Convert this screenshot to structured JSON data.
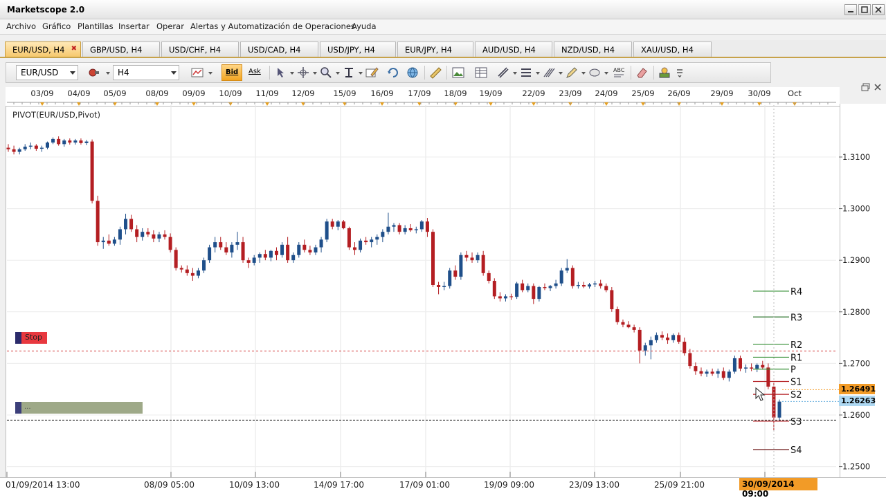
{
  "app": {
    "title": "Marketscope 2.0"
  },
  "menu": [
    "Archivo",
    "Gráfico",
    "Plantillas",
    "Insertar",
    "Operar",
    "Alertas y Automatización de Operaciones",
    "Ayuda"
  ],
  "tabs": [
    "EUR/USD, H4",
    "GBP/USD, H4",
    "USD/CHF, H4",
    "USD/CAD, H4",
    "USD/JPY, H4",
    "EUR/JPY, H4",
    "AUD/USD, H4",
    "NZD/USD, H4",
    "XAU/USD, H4"
  ],
  "toolbar": {
    "symbol": "EUR/USD",
    "timeframe": "H4",
    "bid_label": "Bid",
    "ask_label": "Ask"
  },
  "top_dates": [
    "03/09",
    "04/09",
    "05/09",
    "08/09",
    "09/09",
    "10/09",
    "11/09",
    "12/09",
    "15/09",
    "16/09",
    "17/09",
    "18/09",
    "19/09",
    "22/09",
    "23/09",
    "24/09",
    "25/09",
    "26/09",
    "29/09",
    "30/09",
    "Oct"
  ],
  "indicator": "PIVOT(EUR/USD,Pivot)",
  "price_axis": [
    "1.3100",
    "1.3000",
    "1.2900",
    "1.2800",
    "1.2700",
    "1.2600",
    "1.2500"
  ],
  "bottom_times": [
    "01/09/2014 13:00",
    "08/09 05:00",
    "10/09 13:00",
    "14/09 17:00",
    "17/09 01:00",
    "19/09 09:00",
    "23/09 13:00",
    "25/09 21:00"
  ],
  "cursor_time": "30/09/2014 09:00",
  "current_prices": {
    "bid": "1.26491",
    "ask": "1.26263"
  },
  "markers": {
    "stop": "Stop",
    "order": "..."
  },
  "pivots": [
    "R4",
    "R3",
    "R2",
    "R1",
    "P",
    "S1",
    "S2",
    "S3",
    "S4"
  ],
  "colors": {
    "bull": "#1f4f8a",
    "bear": "#b41e22",
    "accent": "#f29b27",
    "tab_active": "#f6c86d"
  },
  "chart_data": {
    "type": "candlestick",
    "symbol": "EUR/USD",
    "timeframe": "H4",
    "ylim": [
      1.248,
      1.318
    ],
    "candles": [
      {
        "o": 1.3118,
        "h": 1.3125,
        "l": 1.311,
        "c": 1.3115
      },
      {
        "o": 1.3115,
        "h": 1.3122,
        "l": 1.3105,
        "c": 1.311
      },
      {
        "o": 1.311,
        "h": 1.3118,
        "l": 1.3105,
        "c": 1.3115
      },
      {
        "o": 1.3115,
        "h": 1.3125,
        "l": 1.3112,
        "c": 1.312
      },
      {
        "o": 1.312,
        "h": 1.3128,
        "l": 1.3115,
        "c": 1.3122
      },
      {
        "o": 1.3122,
        "h": 1.3125,
        "l": 1.3112,
        "c": 1.3116
      },
      {
        "o": 1.3116,
        "h": 1.3122,
        "l": 1.311,
        "c": 1.3118
      },
      {
        "o": 1.3118,
        "h": 1.313,
        "l": 1.3115,
        "c": 1.3128
      },
      {
        "o": 1.3128,
        "h": 1.3138,
        "l": 1.3125,
        "c": 1.3135
      },
      {
        "o": 1.3135,
        "h": 1.314,
        "l": 1.3122,
        "c": 1.3125
      },
      {
        "o": 1.3125,
        "h": 1.3135,
        "l": 1.312,
        "c": 1.3132
      },
      {
        "o": 1.3132,
        "h": 1.3136,
        "l": 1.3124,
        "c": 1.3128
      },
      {
        "o": 1.3128,
        "h": 1.3135,
        "l": 1.3124,
        "c": 1.3132
      },
      {
        "o": 1.3132,
        "h": 1.3136,
        "l": 1.3124,
        "c": 1.3127
      },
      {
        "o": 1.3127,
        "h": 1.3133,
        "l": 1.3123,
        "c": 1.313
      },
      {
        "o": 1.313,
        "h": 1.3134,
        "l": 1.301,
        "c": 1.3015
      },
      {
        "o": 1.3015,
        "h": 1.3025,
        "l": 1.2928,
        "c": 1.2935
      },
      {
        "o": 1.2935,
        "h": 1.2945,
        "l": 1.2922,
        "c": 1.2938
      },
      {
        "o": 1.2938,
        "h": 1.295,
        "l": 1.2928,
        "c": 1.2932
      },
      {
        "o": 1.2932,
        "h": 1.2945,
        "l": 1.2928,
        "c": 1.294
      },
      {
        "o": 1.294,
        "h": 1.2965,
        "l": 1.293,
        "c": 1.296
      },
      {
        "o": 1.296,
        "h": 1.299,
        "l": 1.295,
        "c": 1.298
      },
      {
        "o": 1.298,
        "h": 1.2988,
        "l": 1.2955,
        "c": 1.296
      },
      {
        "o": 1.296,
        "h": 1.2968,
        "l": 1.2935,
        "c": 1.2945
      },
      {
        "o": 1.2945,
        "h": 1.2962,
        "l": 1.2938,
        "c": 1.2955
      },
      {
        "o": 1.2955,
        "h": 1.2962,
        "l": 1.2945,
        "c": 1.295
      },
      {
        "o": 1.295,
        "h": 1.2958,
        "l": 1.2935,
        "c": 1.2942
      },
      {
        "o": 1.2942,
        "h": 1.2955,
        "l": 1.2935,
        "c": 1.295
      },
      {
        "o": 1.295,
        "h": 1.2958,
        "l": 1.294,
        "c": 1.2945
      },
      {
        "o": 1.2945,
        "h": 1.2952,
        "l": 1.2915,
        "c": 1.292
      },
      {
        "o": 1.292,
        "h": 1.2925,
        "l": 1.288,
        "c": 1.2885
      },
      {
        "o": 1.2885,
        "h": 1.289,
        "l": 1.2876,
        "c": 1.2882
      },
      {
        "o": 1.2882,
        "h": 1.289,
        "l": 1.287,
        "c": 1.2875
      },
      {
        "o": 1.2875,
        "h": 1.2885,
        "l": 1.286,
        "c": 1.287
      },
      {
        "o": 1.287,
        "h": 1.2885,
        "l": 1.2865,
        "c": 1.288
      },
      {
        "o": 1.288,
        "h": 1.2905,
        "l": 1.2875,
        "c": 1.29
      },
      {
        "o": 1.29,
        "h": 1.293,
        "l": 1.2895,
        "c": 1.2925
      },
      {
        "o": 1.2925,
        "h": 1.2945,
        "l": 1.2915,
        "c": 1.2935
      },
      {
        "o": 1.2935,
        "h": 1.2945,
        "l": 1.292,
        "c": 1.2925
      },
      {
        "o": 1.2925,
        "h": 1.2935,
        "l": 1.291,
        "c": 1.2915
      },
      {
        "o": 1.2915,
        "h": 1.2935,
        "l": 1.2905,
        "c": 1.293
      },
      {
        "o": 1.293,
        "h": 1.2955,
        "l": 1.292,
        "c": 1.2935
      },
      {
        "o": 1.2935,
        "h": 1.2945,
        "l": 1.2895,
        "c": 1.29
      },
      {
        "o": 1.29,
        "h": 1.2905,
        "l": 1.2885,
        "c": 1.2895
      },
      {
        "o": 1.2895,
        "h": 1.291,
        "l": 1.289,
        "c": 1.2905
      },
      {
        "o": 1.2905,
        "h": 1.2915,
        "l": 1.2895,
        "c": 1.2912
      },
      {
        "o": 1.2912,
        "h": 1.292,
        "l": 1.29,
        "c": 1.2905
      },
      {
        "o": 1.2905,
        "h": 1.292,
        "l": 1.2898,
        "c": 1.2918
      },
      {
        "o": 1.2918,
        "h": 1.2925,
        "l": 1.29,
        "c": 1.291
      },
      {
        "o": 1.291,
        "h": 1.2935,
        "l": 1.2905,
        "c": 1.293
      },
      {
        "o": 1.293,
        "h": 1.2945,
        "l": 1.2895,
        "c": 1.29
      },
      {
        "o": 1.29,
        "h": 1.2915,
        "l": 1.2895,
        "c": 1.291
      },
      {
        "o": 1.291,
        "h": 1.2935,
        "l": 1.2905,
        "c": 1.293
      },
      {
        "o": 1.293,
        "h": 1.294,
        "l": 1.2915,
        "c": 1.292
      },
      {
        "o": 1.292,
        "h": 1.2928,
        "l": 1.291,
        "c": 1.2915
      },
      {
        "o": 1.2915,
        "h": 1.293,
        "l": 1.291,
        "c": 1.2925
      },
      {
        "o": 1.2925,
        "h": 1.2945,
        "l": 1.2915,
        "c": 1.294
      },
      {
        "o": 1.294,
        "h": 1.298,
        "l": 1.2935,
        "c": 1.2975
      },
      {
        "o": 1.2975,
        "h": 1.298,
        "l": 1.296,
        "c": 1.2965
      },
      {
        "o": 1.2965,
        "h": 1.2978,
        "l": 1.2958,
        "c": 1.2975
      },
      {
        "o": 1.2975,
        "h": 1.2978,
        "l": 1.296,
        "c": 1.2962
      },
      {
        "o": 1.2962,
        "h": 1.2965,
        "l": 1.292,
        "c": 1.2925
      },
      {
        "o": 1.2925,
        "h": 1.2935,
        "l": 1.291,
        "c": 1.292
      },
      {
        "o": 1.292,
        "h": 1.2942,
        "l": 1.2915,
        "c": 1.2938
      },
      {
        "o": 1.2938,
        "h": 1.2945,
        "l": 1.293,
        "c": 1.2935
      },
      {
        "o": 1.2935,
        "h": 1.2945,
        "l": 1.2925,
        "c": 1.294
      },
      {
        "o": 1.294,
        "h": 1.295,
        "l": 1.293,
        "c": 1.2945
      },
      {
        "o": 1.2945,
        "h": 1.296,
        "l": 1.2935,
        "c": 1.2955
      },
      {
        "o": 1.2955,
        "h": 1.2992,
        "l": 1.295,
        "c": 1.2965
      },
      {
        "o": 1.2965,
        "h": 1.2972,
        "l": 1.2955,
        "c": 1.2968
      },
      {
        "o": 1.2968,
        "h": 1.2972,
        "l": 1.295,
        "c": 1.2955
      },
      {
        "o": 1.2955,
        "h": 1.2968,
        "l": 1.295,
        "c": 1.2962
      },
      {
        "o": 1.2962,
        "h": 1.297,
        "l": 1.2955,
        "c": 1.2958
      },
      {
        "o": 1.2958,
        "h": 1.2965,
        "l": 1.2952,
        "c": 1.296
      },
      {
        "o": 1.296,
        "h": 1.2978,
        "l": 1.2955,
        "c": 1.2975
      },
      {
        "o": 1.2975,
        "h": 1.2982,
        "l": 1.2945,
        "c": 1.2955
      },
      {
        "o": 1.2955,
        "h": 1.296,
        "l": 1.2848,
        "c": 1.2852
      },
      {
        "o": 1.2852,
        "h": 1.2858,
        "l": 1.2834,
        "c": 1.2848
      },
      {
        "o": 1.2848,
        "h": 1.2858,
        "l": 1.2842,
        "c": 1.285
      },
      {
        "o": 1.285,
        "h": 1.2885,
        "l": 1.2845,
        "c": 1.288
      },
      {
        "o": 1.288,
        "h": 1.289,
        "l": 1.2862,
        "c": 1.2868
      },
      {
        "o": 1.2868,
        "h": 1.2915,
        "l": 1.2862,
        "c": 1.291
      },
      {
        "o": 1.291,
        "h": 1.2918,
        "l": 1.2898,
        "c": 1.2905
      },
      {
        "o": 1.2905,
        "h": 1.2915,
        "l": 1.2895,
        "c": 1.29
      },
      {
        "o": 1.29,
        "h": 1.2915,
        "l": 1.2895,
        "c": 1.291
      },
      {
        "o": 1.291,
        "h": 1.2918,
        "l": 1.287,
        "c": 1.2875
      },
      {
        "o": 1.2875,
        "h": 1.288,
        "l": 1.2855,
        "c": 1.286
      },
      {
        "o": 1.286,
        "h": 1.2865,
        "l": 1.2825,
        "c": 1.283
      },
      {
        "o": 1.283,
        "h": 1.2838,
        "l": 1.282,
        "c": 1.2826
      },
      {
        "o": 1.2826,
        "h": 1.2834,
        "l": 1.282,
        "c": 1.283
      },
      {
        "o": 1.283,
        "h": 1.2835,
        "l": 1.2823,
        "c": 1.2829
      },
      {
        "o": 1.2829,
        "h": 1.2858,
        "l": 1.2825,
        "c": 1.2855
      },
      {
        "o": 1.2855,
        "h": 1.2862,
        "l": 1.2838,
        "c": 1.2842
      },
      {
        "o": 1.2842,
        "h": 1.2855,
        "l": 1.2838,
        "c": 1.285
      },
      {
        "o": 1.285,
        "h": 1.2855,
        "l": 1.2815,
        "c": 1.2825
      },
      {
        "o": 1.2825,
        "h": 1.285,
        "l": 1.282,
        "c": 1.2848
      },
      {
        "o": 1.2848,
        "h": 1.2855,
        "l": 1.2842,
        "c": 1.2846
      },
      {
        "o": 1.2846,
        "h": 1.2852,
        "l": 1.284,
        "c": 1.285
      },
      {
        "o": 1.285,
        "h": 1.2862,
        "l": 1.2845,
        "c": 1.2855
      },
      {
        "o": 1.2855,
        "h": 1.2885,
        "l": 1.285,
        "c": 1.288
      },
      {
        "o": 1.288,
        "h": 1.2902,
        "l": 1.2875,
        "c": 1.2885
      },
      {
        "o": 1.2885,
        "h": 1.289,
        "l": 1.2845,
        "c": 1.285
      },
      {
        "o": 1.285,
        "h": 1.2858,
        "l": 1.2845,
        "c": 1.2852
      },
      {
        "o": 1.2852,
        "h": 1.2858,
        "l": 1.2846,
        "c": 1.2849
      },
      {
        "o": 1.2849,
        "h": 1.2856,
        "l": 1.2845,
        "c": 1.2853
      },
      {
        "o": 1.2853,
        "h": 1.286,
        "l": 1.2848,
        "c": 1.2855
      },
      {
        "o": 1.2855,
        "h": 1.2862,
        "l": 1.2845,
        "c": 1.285
      },
      {
        "o": 1.285,
        "h": 1.2855,
        "l": 1.2838,
        "c": 1.2842
      },
      {
        "o": 1.2842,
        "h": 1.2848,
        "l": 1.28,
        "c": 1.2805
      },
      {
        "o": 1.2805,
        "h": 1.281,
        "l": 1.2775,
        "c": 1.278
      },
      {
        "o": 1.278,
        "h": 1.2785,
        "l": 1.277,
        "c": 1.2775
      },
      {
        "o": 1.2775,
        "h": 1.2782,
        "l": 1.2768,
        "c": 1.277
      },
      {
        "o": 1.277,
        "h": 1.2775,
        "l": 1.276,
        "c": 1.2765
      },
      {
        "o": 1.2765,
        "h": 1.277,
        "l": 1.27,
        "c": 1.2725
      },
      {
        "o": 1.2725,
        "h": 1.274,
        "l": 1.2715,
        "c": 1.2735
      },
      {
        "o": 1.2735,
        "h": 1.2752,
        "l": 1.2708,
        "c": 1.2745
      },
      {
        "o": 1.2745,
        "h": 1.276,
        "l": 1.274,
        "c": 1.2755
      },
      {
        "o": 1.2755,
        "h": 1.2762,
        "l": 1.2745,
        "c": 1.275
      },
      {
        "o": 1.275,
        "h": 1.2758,
        "l": 1.2738,
        "c": 1.2745
      },
      {
        "o": 1.2745,
        "h": 1.2758,
        "l": 1.274,
        "c": 1.2755
      },
      {
        "o": 1.2755,
        "h": 1.276,
        "l": 1.2738,
        "c": 1.2742
      },
      {
        "o": 1.2742,
        "h": 1.275,
        "l": 1.2715,
        "c": 1.272
      },
      {
        "o": 1.272,
        "h": 1.2728,
        "l": 1.269,
        "c": 1.2695
      },
      {
        "o": 1.2695,
        "h": 1.2702,
        "l": 1.2678,
        "c": 1.2685
      },
      {
        "o": 1.2685,
        "h": 1.2692,
        "l": 1.2675,
        "c": 1.268
      },
      {
        "o": 1.268,
        "h": 1.2688,
        "l": 1.2674,
        "c": 1.2684
      },
      {
        "o": 1.2684,
        "h": 1.269,
        "l": 1.2676,
        "c": 1.268
      },
      {
        "o": 1.268,
        "h": 1.269,
        "l": 1.2672,
        "c": 1.2685
      },
      {
        "o": 1.2685,
        "h": 1.2692,
        "l": 1.2668,
        "c": 1.2672
      },
      {
        "o": 1.2672,
        "h": 1.2688,
        "l": 1.2665,
        "c": 1.2684
      },
      {
        "o": 1.2684,
        "h": 1.2715,
        "l": 1.268,
        "c": 1.271
      },
      {
        "o": 1.271,
        "h": 1.2715,
        "l": 1.2685,
        "c": 1.269
      },
      {
        "o": 1.269,
        "h": 1.2698,
        "l": 1.2682,
        "c": 1.2692
      },
      {
        "o": 1.2692,
        "h": 1.27,
        "l": 1.2685,
        "c": 1.269
      },
      {
        "o": 1.269,
        "h": 1.27,
        "l": 1.2683,
        "c": 1.2697
      },
      {
        "o": 1.2697,
        "h": 1.2705,
        "l": 1.2688,
        "c": 1.2692
      },
      {
        "o": 1.2692,
        "h": 1.27,
        "l": 1.265,
        "c": 1.2655
      },
      {
        "o": 1.2655,
        "h": 1.2662,
        "l": 1.257,
        "c": 1.2595
      },
      {
        "o": 1.2595,
        "h": 1.263,
        "l": 1.2588,
        "c": 1.2626
      }
    ],
    "pivots": {
      "R4": 1.284,
      "R3": 1.279,
      "R2": 1.2737,
      "R1": 1.2712,
      "P": 1.2689,
      "S1": 1.2665,
      "S2": 1.264,
      "S3": 1.2588,
      "S4": 1.2533
    },
    "levels": {
      "stop": 1.2724,
      "order": 1.259
    },
    "bid": 1.26491,
    "ask": 1.26263
  }
}
